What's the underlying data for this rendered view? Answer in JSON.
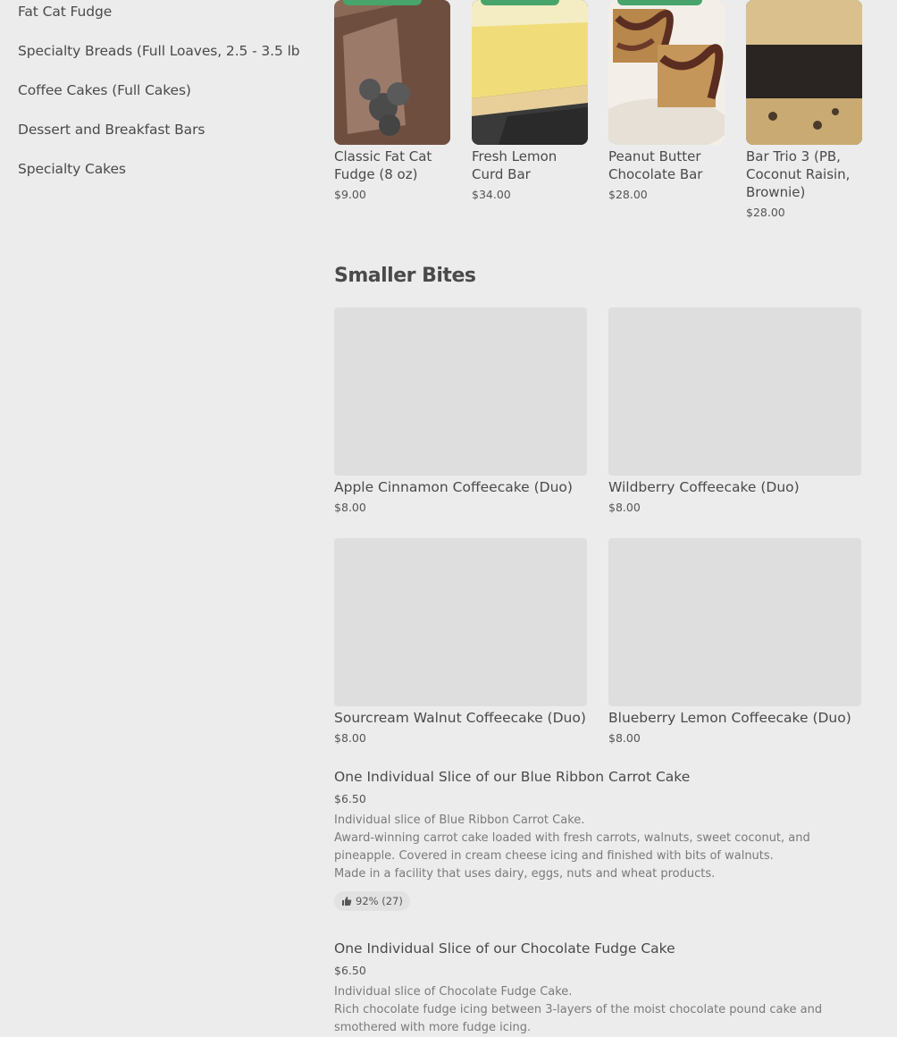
{
  "sidebar": {
    "items": [
      {
        "label": "Fat Cat Fudge"
      },
      {
        "label": "Specialty Breads (Full Loaves, 2.5 - 3.5 lb"
      },
      {
        "label": "Coffee Cakes (Full Cakes)"
      },
      {
        "label": "Dessert and Breakfast Bars"
      },
      {
        "label": "Specialty Cakes"
      }
    ]
  },
  "featured": [
    {
      "title": "Classic Fat Cat Fudge (8 oz)",
      "price": "$9.00"
    },
    {
      "title": "Fresh Lemon Curd Bar",
      "price": "$34.00"
    },
    {
      "title": "Peanut Butter Chocolate Bar",
      "price": "$28.00"
    },
    {
      "title": "Bar Trio 3 (PB, Coconut Raisin, Brownie)",
      "price": "$28.00"
    }
  ],
  "section": {
    "title": "Smaller Bites"
  },
  "grid": [
    {
      "title": "Apple Cinnamon Coffeecake (Duo)",
      "price": "$8.00"
    },
    {
      "title": "Wildberry Coffeecake (Duo)",
      "price": "$8.00"
    },
    {
      "title": "Sourcream Walnut Coffeecake (Duo)",
      "price": "$8.00"
    },
    {
      "title": "Blueberry Lemon Coffeecake (Duo)",
      "price": "$8.00"
    }
  ],
  "list": [
    {
      "title": "One Individual Slice of our Blue Ribbon Carrot Cake",
      "price": "$6.50",
      "desc": [
        "Individual slice of Blue Ribbon Carrot Cake.",
        "Award-winning carrot cake loaded with fresh carrots, walnuts, sweet coconut, and pineapple. Covered in cream cheese icing and finished with bits of walnuts.",
        "Made in a facility that uses dairy, eggs, nuts and wheat products."
      ],
      "rating": "92% (27)"
    },
    {
      "title": "One Individual Slice of our Chocolate Fudge Cake",
      "price": "$6.50",
      "desc": [
        "Individual slice of Chocolate Fudge Cake.",
        "Rich chocolate fudge icing between 3-layers of the moist chocolate pound cake and smothered with more fudge icing."
      ]
    }
  ],
  "icons": {
    "rating": "thumbs-up-icon"
  },
  "colors": {
    "badge": "#47a46a",
    "background": "#ececec",
    "placeholder": "#dedede"
  }
}
